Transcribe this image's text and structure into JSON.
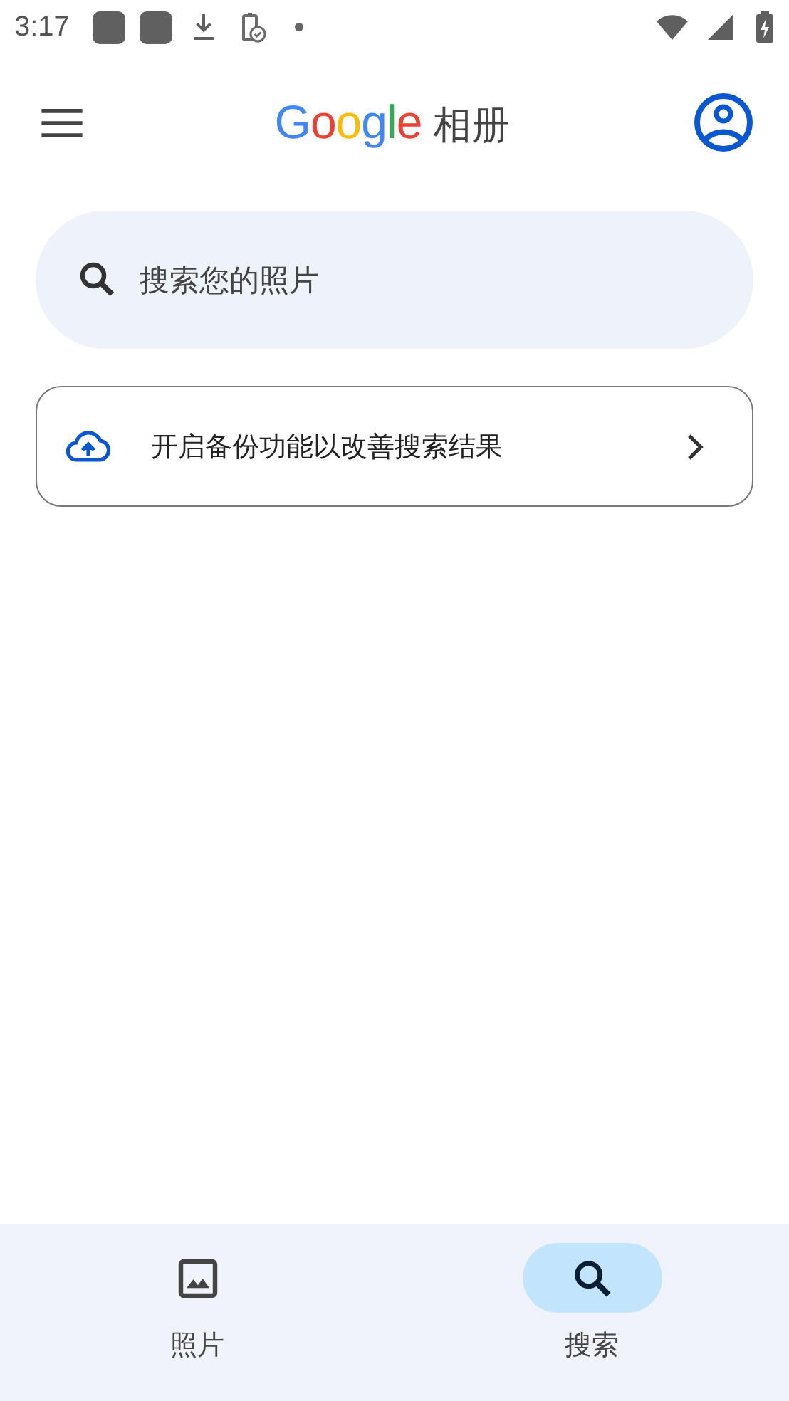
{
  "status_bar": {
    "time": "3:17"
  },
  "app_bar": {
    "logo": "Google",
    "title": "相册"
  },
  "search": {
    "placeholder": "搜索您的照片"
  },
  "backup_card": {
    "text": "开启备份功能以改善搜索结果"
  },
  "bottom_nav": [
    {
      "kind": "photos",
      "label": "照片",
      "selected": false
    },
    {
      "kind": "search",
      "label": "搜索",
      "selected": true
    }
  ]
}
